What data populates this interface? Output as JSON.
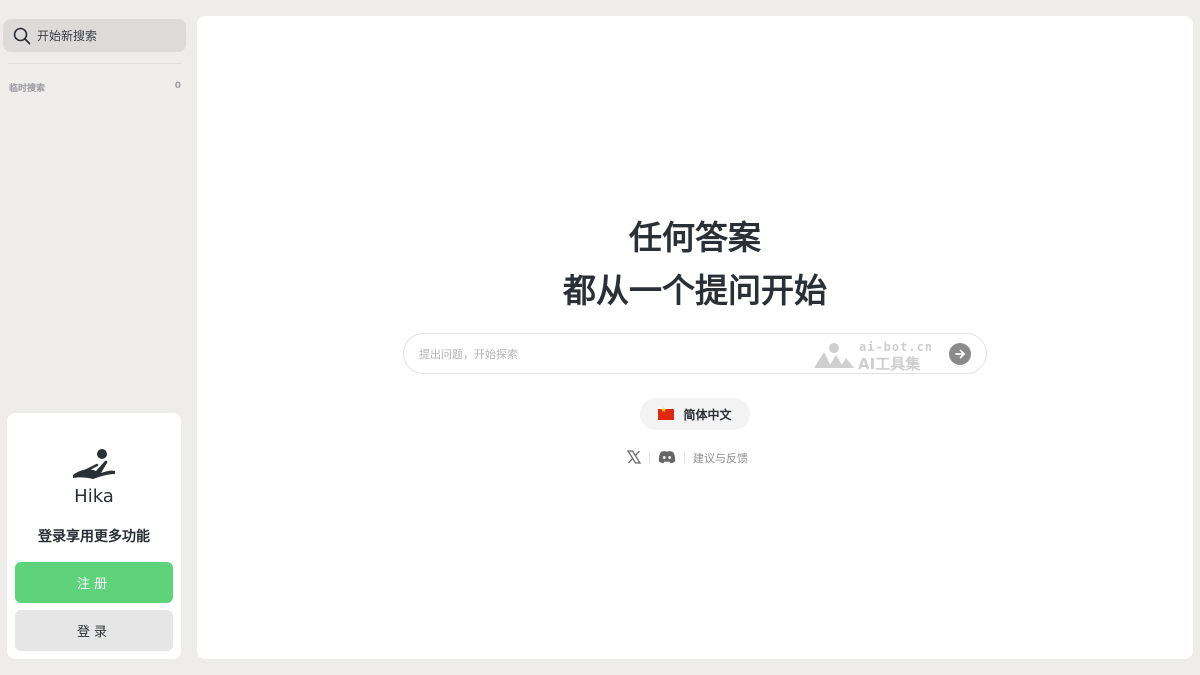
{
  "sidebar": {
    "new_search_label": "开始新搜索",
    "section_label": "临时搜索",
    "section_count": "0",
    "login_card": {
      "brand_name": "Hika",
      "promo_text": "登录享用更多功能",
      "register_label": "注册",
      "login_label": "登录"
    }
  },
  "main": {
    "hero_line1": "任何答案",
    "hero_line2": "都从一个提问开始",
    "search_placeholder": "提出问题，开始探索",
    "watermark_url": "ai-bot.cn",
    "watermark_name": "AI工具集",
    "language_label": "简体中文",
    "feedback_label": "建议与反馈"
  },
  "colors": {
    "page_background": "#efedeb",
    "accent_green": "#5fd37a",
    "text_primary": "#2b2f36",
    "submit_button": "#8a8a8a"
  },
  "icons": {
    "new_search": "search-icon",
    "submit": "arrow-right-icon",
    "flag": "china-flag-icon",
    "x": "x-twitter-icon",
    "discord": "discord-icon",
    "logo": "hika-reading-figure-logo"
  }
}
